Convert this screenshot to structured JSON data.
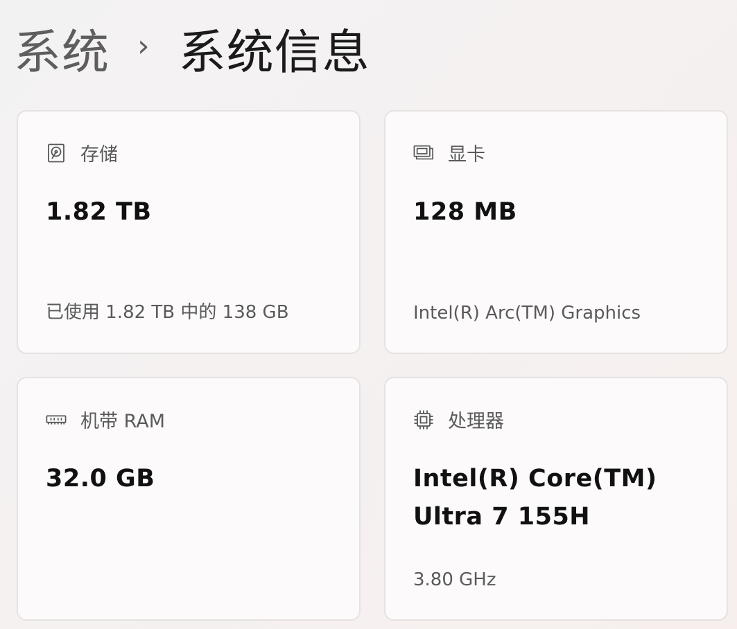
{
  "breadcrumb": {
    "parent": "系统",
    "separator": "›",
    "current": "系统信息"
  },
  "cards": {
    "storage": {
      "icon": "hard-drive-icon",
      "title": "存储",
      "value": "1.82 TB",
      "detail": "已使用 1.82 TB 中的 138 GB"
    },
    "gpu": {
      "icon": "graphics-card-icon",
      "title": "显卡",
      "value": "128 MB",
      "detail": "Intel(R) Arc(TM) Graphics"
    },
    "ram": {
      "icon": "memory-module-icon",
      "title": "机带 RAM",
      "value": "32.0 GB"
    },
    "cpu": {
      "icon": "processor-chip-icon",
      "title": "处理器",
      "value": "Intel(R) Core(TM) Ultra 7 155H",
      "detail": "3.80 GHz"
    }
  },
  "colors": {
    "card_border": "#e6e2e2",
    "muted_text": "#5a5a5a",
    "primary_text": "#111111"
  }
}
